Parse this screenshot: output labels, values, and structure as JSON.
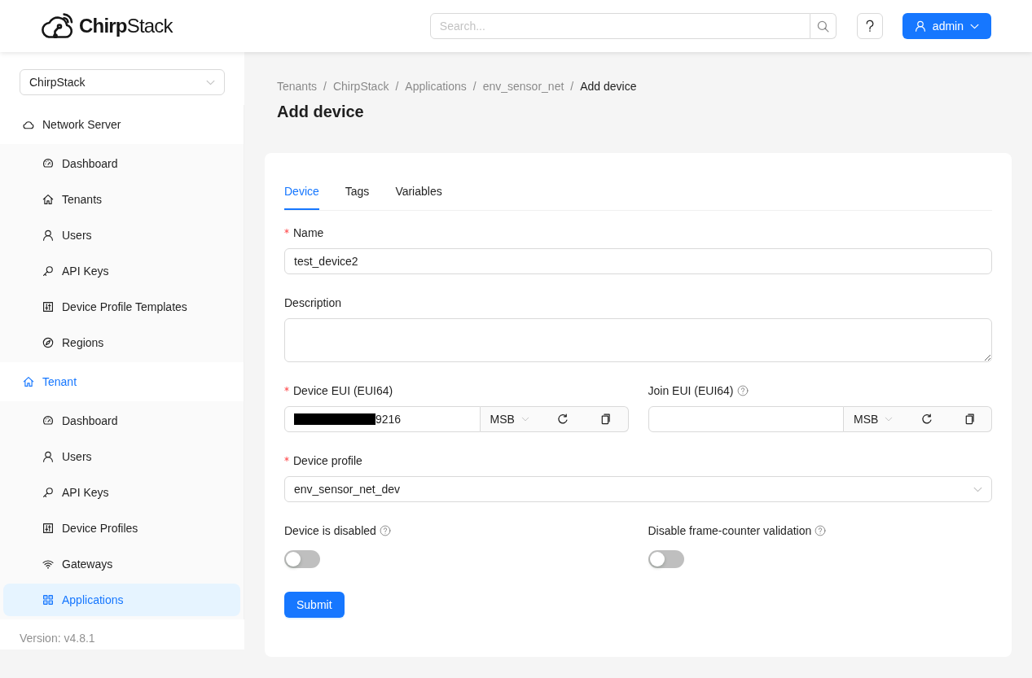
{
  "header": {
    "logo": "**Chirp**Stack",
    "search": {
      "placeholder": "Search..."
    },
    "user_menu": {
      "label": "admin"
    }
  },
  "sidebar": {
    "tenant_select": {
      "value": "ChirpStack"
    },
    "groups": [
      {
        "label": "Network Server",
        "kind": "cloud",
        "selected": false,
        "items": [
          {
            "label": "Dashboard",
            "kind": "gauge",
            "selected": false
          },
          {
            "label": "Tenants",
            "kind": "home",
            "selected": false
          },
          {
            "label": "Users",
            "kind": "user",
            "selected": false
          },
          {
            "label": "API Keys",
            "kind": "key",
            "selected": false
          },
          {
            "label": "Device Profile Templates",
            "kind": "sliders",
            "selected": false
          },
          {
            "label": "Regions",
            "kind": "compass",
            "selected": false
          }
        ]
      },
      {
        "label": "Tenant",
        "kind": "home",
        "selected": true,
        "items": [
          {
            "label": "Dashboard",
            "kind": "gauge",
            "selected": false
          },
          {
            "label": "Users",
            "kind": "user",
            "selected": false
          },
          {
            "label": "API Keys",
            "kind": "key",
            "selected": false
          },
          {
            "label": "Device Profiles",
            "kind": "sliders",
            "selected": false
          },
          {
            "label": "Gateways",
            "kind": "wifi",
            "selected": false
          },
          {
            "label": "Applications",
            "kind": "grid",
            "selected": true
          }
        ]
      }
    ],
    "version": "Version: v4.8.1"
  },
  "breadcrumb": [
    {
      "kind": "link",
      "text": "Tenants"
    },
    {
      "kind": "separator",
      "text": "/"
    },
    {
      "kind": "link",
      "text": "ChirpStack"
    },
    {
      "kind": "separator",
      "text": "/"
    },
    {
      "kind": "link",
      "text": "Applications"
    },
    {
      "kind": "separator",
      "text": "/"
    },
    {
      "kind": "link",
      "text": "env_sensor_net"
    },
    {
      "kind": "separator",
      "text": "/"
    },
    {
      "kind": "current",
      "text": "Add device"
    }
  ],
  "page_title": "Add device",
  "tabs": [
    {
      "label": "Device",
      "selected": true
    },
    {
      "label": "Tags",
      "selected": false
    },
    {
      "label": "Variables",
      "selected": false
    }
  ],
  "form": {
    "rows": [
      [
        {
          "kind": "text",
          "label": "Name",
          "required": true,
          "value": "test_device2"
        }
      ],
      [
        {
          "kind": "textarea",
          "label": "Description",
          "required": false
        }
      ],
      [
        {
          "kind": "eui",
          "label": "Device EUI (EUI64)",
          "required": true,
          "help": false,
          "redacted": true,
          "value": "9216",
          "byte_order": "MSB"
        },
        {
          "kind": "eui",
          "label": "Join EUI (EUI64)",
          "required": false,
          "help": true,
          "redacted": false,
          "byte_order": "MSB"
        }
      ],
      [
        {
          "kind": "select",
          "label": "Device profile",
          "required": true,
          "value": "env_sensor_net_dev"
        }
      ],
      [
        {
          "kind": "switch",
          "label": "Device is disabled",
          "help": true,
          "on": false
        },
        {
          "kind": "switch",
          "label": "Disable frame-counter validation",
          "help": true,
          "on": false
        }
      ]
    ]
  },
  "submit_button": "Submit"
}
